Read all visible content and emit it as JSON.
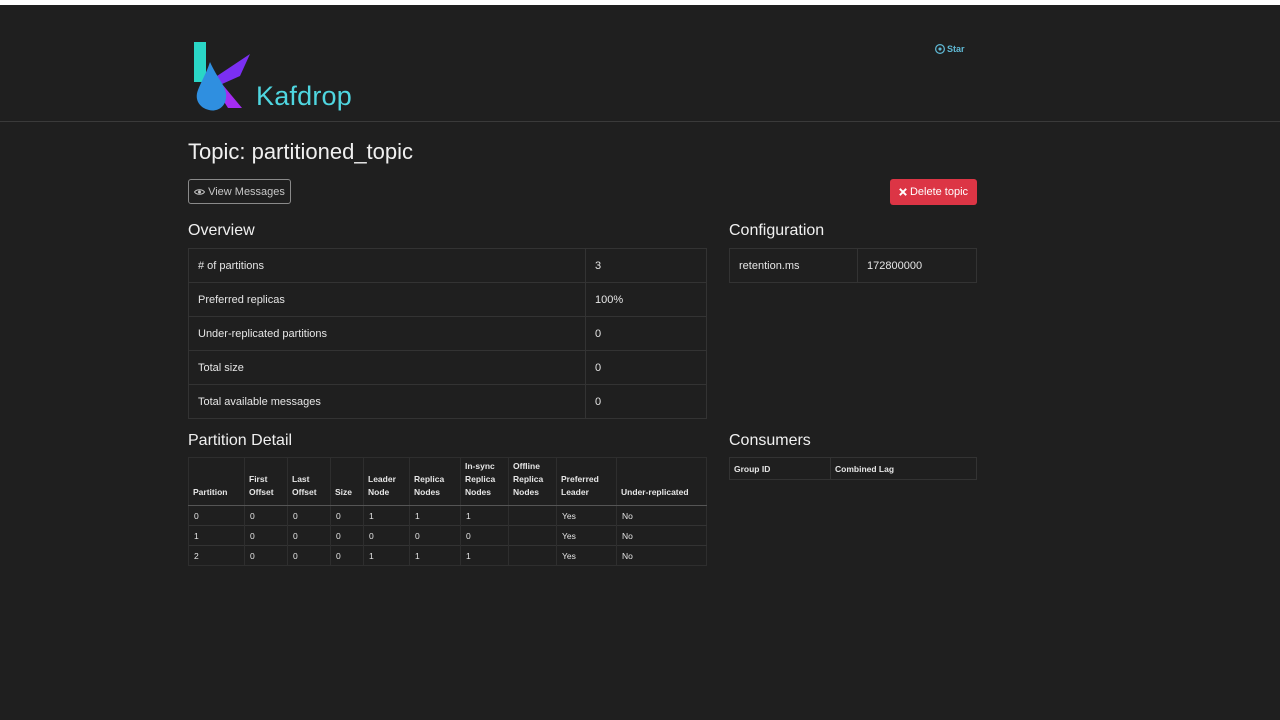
{
  "header": {
    "brand": "Kafdrop",
    "star_label": "Star"
  },
  "topic": {
    "title": "Topic: partitioned_topic",
    "view_messages_label": "View Messages",
    "delete_label": "Delete topic"
  },
  "overview": {
    "title": "Overview",
    "rows": [
      {
        "label": "# of partitions",
        "value": "3"
      },
      {
        "label": "Preferred replicas",
        "value": "100%"
      },
      {
        "label": "Under-replicated partitions",
        "value": "0"
      },
      {
        "label": "Total size",
        "value": "0"
      },
      {
        "label": "Total available messages",
        "value": "0"
      }
    ]
  },
  "configuration": {
    "title": "Configuration",
    "rows": [
      {
        "label": "retention.ms",
        "value": "172800000"
      }
    ]
  },
  "partition_detail": {
    "title": "Partition Detail",
    "columns": [
      "Partition",
      "First Offset",
      "Last Offset",
      "Size",
      "Leader Node",
      "Replica Nodes",
      "In-sync Replica Nodes",
      "Offline Replica Nodes",
      "Preferred Leader",
      "Under-replicated"
    ],
    "rows": [
      [
        "0",
        "0",
        "0",
        "0",
        "1",
        "1",
        "1",
        "",
        "Yes",
        "No"
      ],
      [
        "1",
        "0",
        "0",
        "0",
        "0",
        "0",
        "0",
        "",
        "Yes",
        "No"
      ],
      [
        "2",
        "0",
        "0",
        "0",
        "1",
        "1",
        "1",
        "",
        "Yes",
        "No"
      ]
    ]
  },
  "consumers": {
    "title": "Consumers",
    "columns": [
      "Group ID",
      "Combined Lag"
    ]
  },
  "colors": {
    "brand": "#4fd6e0",
    "danger": "#dc3545",
    "link": "#5fb8d4",
    "background": "#1f1f1f"
  },
  "icons": {
    "star": "github-icon",
    "view": "eye-icon",
    "delete": "x-icon"
  }
}
